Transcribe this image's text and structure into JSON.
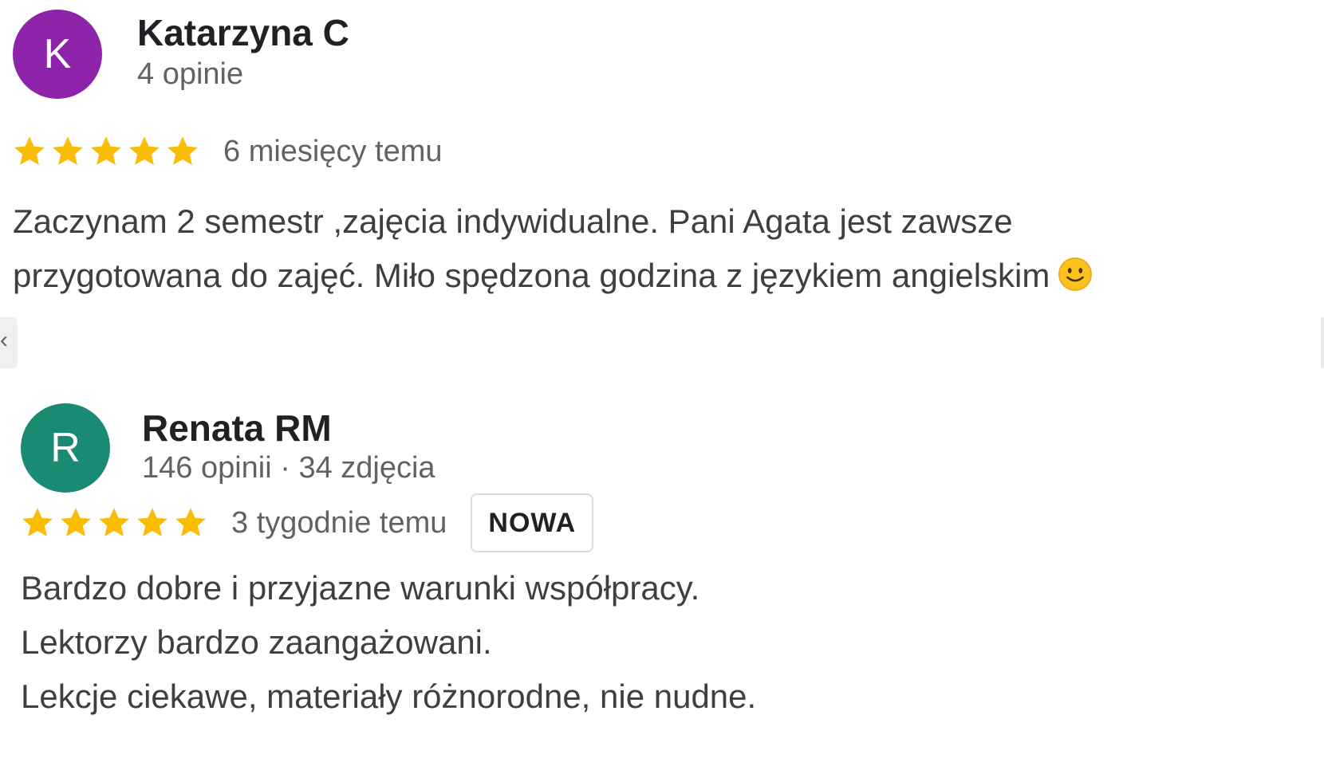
{
  "reviews": [
    {
      "avatar_letter": "K",
      "avatar_color": "#8e24aa",
      "name": "Katarzyna C",
      "meta": "4 opinie",
      "rating": 5,
      "time": "6 miesięcy temu",
      "lines": [
        "Zaczynam 2 semestr ,zajęcia indywidualne. Pani Agata jest zawsze",
        "przygotowana do zajęć. Miło spędzona godzina z językiem angielskim"
      ],
      "emoji_icon": "slightly-smiling-face-icon"
    },
    {
      "avatar_letter": "R",
      "avatar_color": "#1b8a72",
      "name": "Renata RM",
      "meta": "146 opinii · 34 zdjęcia",
      "rating": 5,
      "time": "3 tygodnie temu",
      "badge": "NOWA",
      "lines": [
        "Bardzo dobre i przyjazne warunki współpracy.",
        "Lektorzy bardzo zaangażowani.",
        "Lekcje ciekawe, materiały różnorodne, nie nudne."
      ]
    }
  ],
  "colors": {
    "star": "#fbbc04",
    "text_primary": "#202124",
    "text_secondary": "#5f6368"
  },
  "icons": {
    "star": "star-icon",
    "edge_arrow": "chevron-left-icon"
  },
  "edge_left_glyph": "‹"
}
